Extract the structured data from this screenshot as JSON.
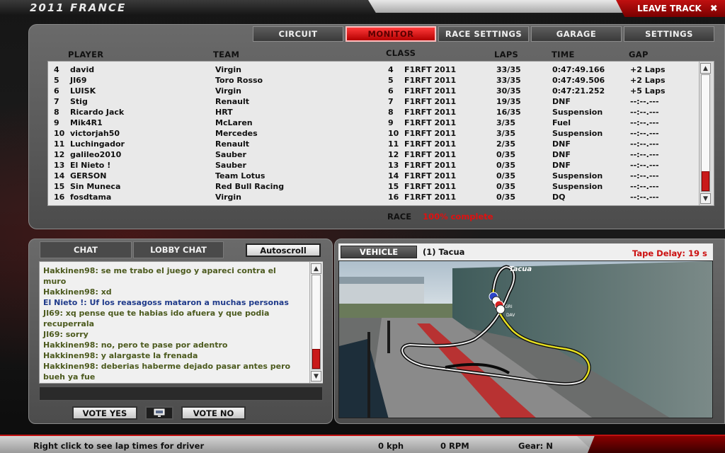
{
  "title": "2011 FRANCE",
  "leave_track": {
    "label": "LEAVE TRACK",
    "close": "✖"
  },
  "tabs": [
    {
      "label": "CIRCUIT"
    },
    {
      "label": "MONITOR"
    },
    {
      "label": "RACE SETTINGS"
    },
    {
      "label": "GARAGE"
    },
    {
      "label": "SETTINGS"
    }
  ],
  "columns": {
    "player": "PLAYER",
    "team": "TEAM",
    "class": "CLASS",
    "laps": "LAPS",
    "time": "TIME",
    "gap": "GAP"
  },
  "rows": [
    {
      "pos": "4",
      "player": "david",
      "team": "Virgin",
      "cls_pos": "4",
      "cls": "F1RFT 2011",
      "laps": "33/35",
      "time": "0:47:49.166",
      "gap": "+2 Laps"
    },
    {
      "pos": "5",
      "player": "JI69",
      "team": "Toro Rosso",
      "cls_pos": "5",
      "cls": "F1RFT 2011",
      "laps": "33/35",
      "time": "0:47:49.506",
      "gap": "+2 Laps"
    },
    {
      "pos": "6",
      "player": "LUISK",
      "team": "Virgin",
      "cls_pos": "6",
      "cls": "F1RFT 2011",
      "laps": "30/35",
      "time": "0:47:21.252",
      "gap": "+5 Laps"
    },
    {
      "pos": "7",
      "player": "Stig",
      "team": "Renault",
      "cls_pos": "7",
      "cls": "F1RFT 2011",
      "laps": "19/35",
      "time": "DNF",
      "gap": "--:--.---"
    },
    {
      "pos": "8",
      "player": "Ricardo Jack",
      "team": "HRT",
      "cls_pos": "8",
      "cls": "F1RFT 2011",
      "laps": "16/35",
      "time": "Suspension",
      "gap": "--:--.---"
    },
    {
      "pos": "9",
      "player": "Mik4R1",
      "team": "McLaren",
      "cls_pos": "9",
      "cls": "F1RFT 2011",
      "laps": "3/35",
      "time": "Fuel",
      "gap": "--:--.---"
    },
    {
      "pos": "10",
      "player": "victorjah50",
      "team": "Mercedes",
      "cls_pos": "10",
      "cls": "F1RFT 2011",
      "laps": "3/35",
      "time": "Suspension",
      "gap": "--:--.---"
    },
    {
      "pos": "11",
      "player": "Luchingador",
      "team": "Renault",
      "cls_pos": "11",
      "cls": "F1RFT 2011",
      "laps": "2/35",
      "time": "DNF",
      "gap": "--:--.---"
    },
    {
      "pos": "12",
      "player": "galileo2010",
      "team": "Sauber",
      "cls_pos": "12",
      "cls": "F1RFT 2011",
      "laps": "0/35",
      "time": "DNF",
      "gap": "--:--.---"
    },
    {
      "pos": "13",
      "player": "El Nieto !",
      "team": "Sauber",
      "cls_pos": "13",
      "cls": "F1RFT 2011",
      "laps": "0/35",
      "time": "DNF",
      "gap": "--:--.---"
    },
    {
      "pos": "14",
      "player": "GERSON",
      "team": "Team Lotus",
      "cls_pos": "14",
      "cls": "F1RFT 2011",
      "laps": "0/35",
      "time": "Suspension",
      "gap": "--:--.---"
    },
    {
      "pos": "15",
      "player": "Sin Muneca",
      "team": "Red Bull Racing",
      "cls_pos": "15",
      "cls": "F1RFT 2011",
      "laps": "0/35",
      "time": "Suspension",
      "gap": "--:--.---"
    },
    {
      "pos": "16",
      "player": "fosdtama",
      "team": "Virgin",
      "cls_pos": "16",
      "cls": "F1RFT 2011",
      "laps": "0/35",
      "time": "DQ",
      "gap": "--:--.---"
    }
  ],
  "race": {
    "label": "RACE",
    "status": "100% complete"
  },
  "chat": {
    "tab_chat": "CHAT",
    "tab_lobby": "LOBBY CHAT",
    "autoscroll": "Autoscroll",
    "lines": [
      {
        "text": "Hakkinen98: se me trabo el juego y apareci contra el",
        "color": "#4c5a1e"
      },
      {
        "text": "muro",
        "color": "#4c5a1e"
      },
      {
        "text": "Hakkinen98: xd",
        "color": "#4c5a1e"
      },
      {
        "text": "El Nieto !: Uf los reasagoss mataron a muchas personas",
        "color": "#1f3a8a"
      },
      {
        "text": "JI69: xq pense que te habias ido afuera y que podia",
        "color": "#4c5a1e"
      },
      {
        "text": "recuperrala",
        "color": "#4c5a1e"
      },
      {
        "text": "JI69: sorry",
        "color": "#4c5a1e"
      },
      {
        "text": "Hakkinen98: no, pero te pase por adentro",
        "color": "#4c5a1e"
      },
      {
        "text": "Hakkinen98: y alargaste la frenada",
        "color": "#4c5a1e"
      },
      {
        "text": "Hakkinen98: deberias haberme dejado pasar antes pero",
        "color": "#4c5a1e"
      },
      {
        "text": "bueh ya fue",
        "color": "#4c5a1e"
      }
    ]
  },
  "vote": {
    "yes": "VOTE YES",
    "no": "VOTE NO"
  },
  "vehicle": {
    "button": "VEHICLE",
    "driver": "(1) Tacua",
    "tape_delay": "Tape Delay: 19 s",
    "map_label": "Tacua",
    "car_labels": [
      "GRI",
      "DAV"
    ]
  },
  "status": {
    "hint": "Right click to see lap times for driver",
    "speed": "0 kph",
    "rpm": "0 RPM",
    "gear": "Gear: N"
  },
  "colors": {
    "accent_red": "#c01010",
    "status_red": "#e01010",
    "chat_green": "#4c5a1e",
    "chat_blue": "#1f3a8a"
  }
}
